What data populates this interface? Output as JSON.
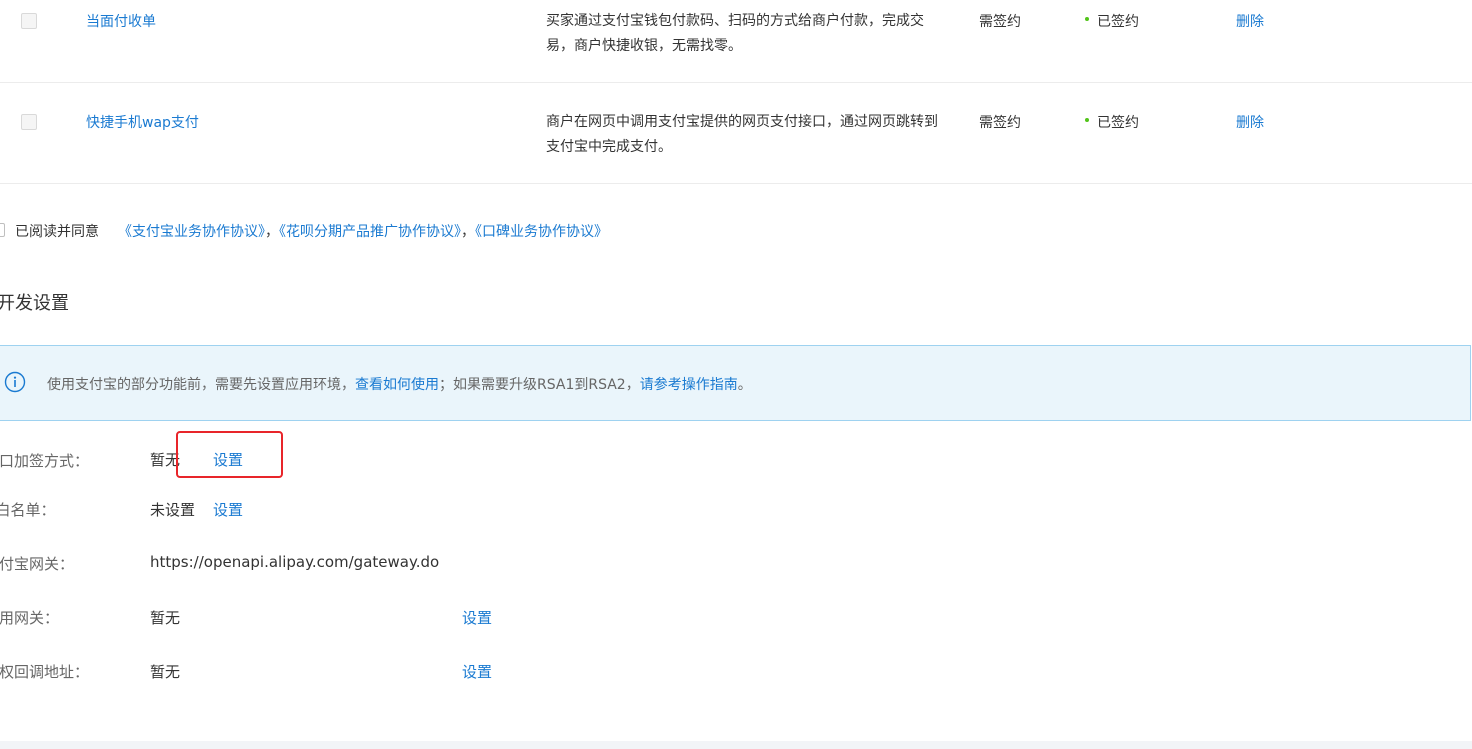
{
  "products": [
    {
      "name": "当面付收单",
      "description": "买家通过支付宝钱包付款码、扫码的方式给商户付款，完成交易，商户快捷收银，无需找零。",
      "sign_requirement": "需签约",
      "status": "已签约",
      "action": "删除"
    },
    {
      "name": "快捷手机wap支付",
      "description": "商户在网页中调用支付宝提供的网页支付接口，通过网页跳转到支付宝中完成支付。",
      "sign_requirement": "需签约",
      "status": "已签约",
      "action": "删除"
    }
  ],
  "agreement": {
    "label": "已阅读并同意",
    "link1": "《支付宝业务协作协议》",
    "sep1": "，",
    "link2": "《花呗分期产品推广协作协议》",
    "sep2": "，",
    "link3": "《口碑业务协作协议》"
  },
  "dev_settings": {
    "title": "开发设置",
    "banner": {
      "text1": "使用支付宝的部分功能前，需要先设置应用环境，",
      "link1": "查看如何使用",
      "text2": "；如果需要升级RSA1到RSA2，",
      "link2": "请参考操作指南",
      "text3": "。"
    },
    "rows": [
      {
        "label": "接口加签方式：",
        "value": "暂无",
        "action": "设置"
      },
      {
        "label": "IP白名单：",
        "value": "未设置",
        "action": "设置"
      },
      {
        "label": "支付宝网关：",
        "value": "https://openapi.alipay.com/gateway.do"
      },
      {
        "label": "应用网关：",
        "value": "暂无",
        "action": "设置"
      },
      {
        "label": "授权回调地址：",
        "value": "暂无",
        "action": "设置"
      }
    ]
  },
  "colors": {
    "link": "#1a7ad1",
    "success_dot": "#52c41a",
    "highlight": "#e8252a",
    "banner_bg": "#eaf5fb",
    "banner_border": "#9ed2f0"
  },
  "icons": {
    "info": "info-circle-icon"
  }
}
